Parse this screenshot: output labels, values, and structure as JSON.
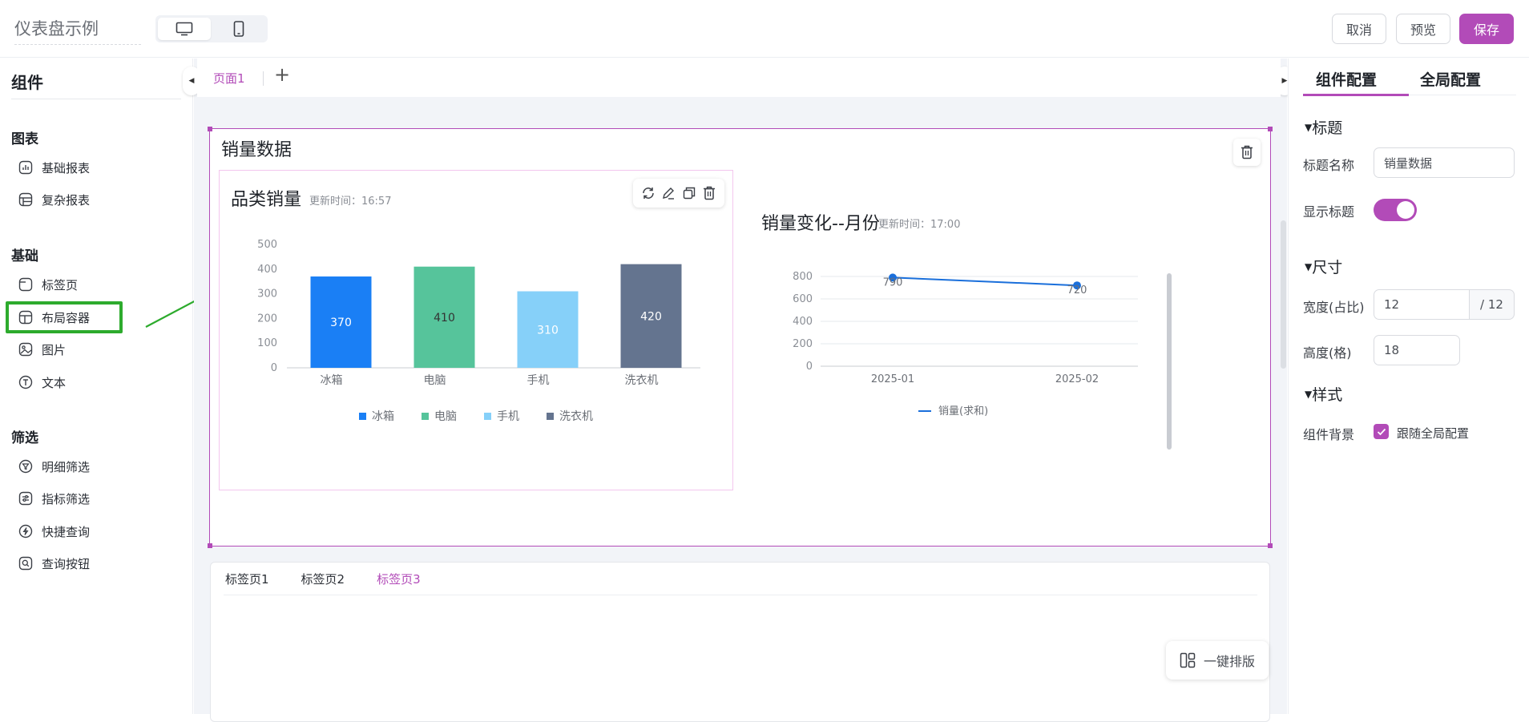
{
  "header": {
    "dashboard_name": "仪表盘示例",
    "device_desktop_icon": "desktop-icon",
    "device_mobile_icon": "mobile-icon",
    "cancel_label": "取消",
    "preview_label": "预览",
    "save_label": "保存",
    "accent_color": "#b24bb8"
  },
  "components_panel": {
    "title": "组件",
    "groups": [
      {
        "label": "图表",
        "items": [
          {
            "label": "基础报表",
            "icon": "bar-chart-icon"
          },
          {
            "label": "复杂报表",
            "icon": "table-chart-icon"
          }
        ]
      },
      {
        "label": "基础",
        "items": [
          {
            "label": "标签页",
            "icon": "tab-icon"
          },
          {
            "label": "布局容器",
            "icon": "layout-icon"
          },
          {
            "label": "图片",
            "icon": "image-icon"
          },
          {
            "label": "文本",
            "icon": "text-icon"
          }
        ]
      },
      {
        "label": "筛选",
        "items": [
          {
            "label": "明细筛选",
            "icon": "filter-icon"
          },
          {
            "label": "指标筛选",
            "icon": "metric-filter-icon"
          },
          {
            "label": "快捷查询",
            "icon": "quick-query-icon"
          },
          {
            "label": "查询按钮",
            "icon": "search-button-icon"
          }
        ]
      }
    ]
  },
  "page_tabs": {
    "active": "页面1",
    "add": "+"
  },
  "layout_container": {
    "title": "销量数据",
    "bar_chart": {
      "title": "品类销量",
      "update_time": "更新时间：16:57"
    },
    "line_chart": {
      "title": "销量变化--月份",
      "update_time": "更新时间：17:00"
    }
  },
  "chart_data": [
    {
      "type": "bar",
      "categories": [
        "冰箱",
        "电脑",
        "手机",
        "洗衣机"
      ],
      "values": [
        370,
        410,
        310,
        420
      ],
      "colors": [
        "#1a7ff5",
        "#56c49b",
        "#86d0f9",
        "#64748f"
      ],
      "legend": [
        "冰箱",
        "电脑",
        "手机",
        "洗衣机"
      ],
      "ylim": [
        0,
        500
      ],
      "yticks": [
        0,
        100,
        200,
        300,
        400,
        500
      ],
      "legend_position": "bottom"
    },
    {
      "type": "line",
      "x": [
        "2025-01",
        "2025-02"
      ],
      "series": [
        {
          "name": "销量(求和)",
          "values": [
            790,
            720
          ],
          "color": "#1a6fdb"
        }
      ],
      "ylim": [
        0,
        800
      ],
      "yticks": [
        0,
        200,
        400,
        600,
        800
      ],
      "legend_position": "bottom"
    }
  ],
  "tabs_component": {
    "tabs": [
      "标签页1",
      "标签页2",
      "标签页3"
    ],
    "active_index": 2
  },
  "auto_layout_label": "一键排版",
  "config_panel": {
    "tab_component": "组件配置",
    "tab_global": "全局配置",
    "section_title": "标题",
    "title_name_label": "标题名称",
    "title_name_value": "销量数据",
    "show_title_label": "显示标题",
    "show_title_on": true,
    "section_size": "尺寸",
    "width_label": "宽度(占比)",
    "width_value": "12",
    "width_suffix": "/ 12",
    "height_label": "高度(格)",
    "height_value": "18",
    "section_style": "样式",
    "bg_label": "组件背景",
    "bg_follow_label": "跟随全局配置",
    "bg_follow_checked": true
  }
}
